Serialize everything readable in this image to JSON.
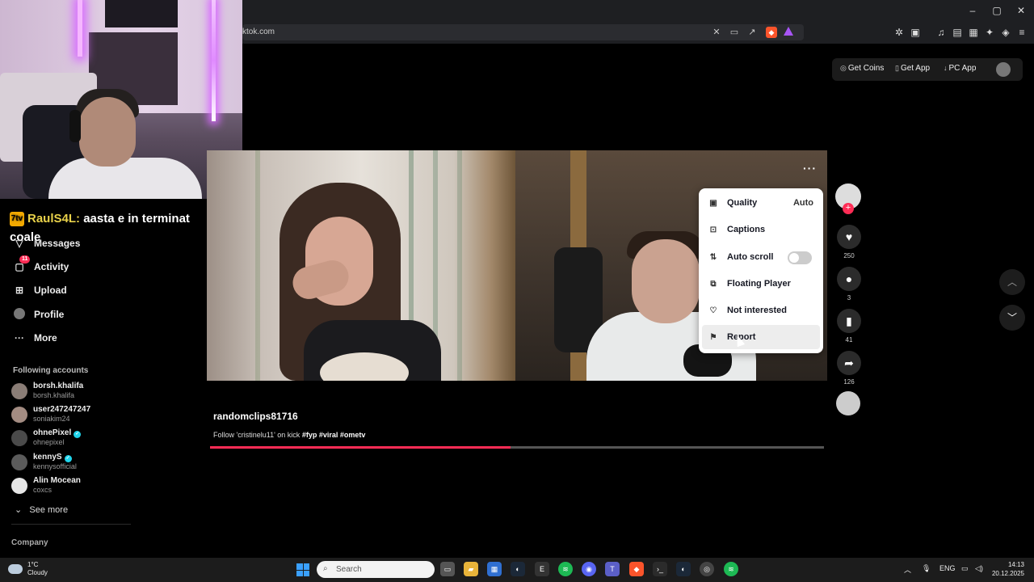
{
  "browser": {
    "url": "ktok.com",
    "window_controls": [
      "–",
      "▢",
      "✕"
    ]
  },
  "stream_chat": {
    "badge": "7tv",
    "username": "RaulS4L:",
    "message": "aasta e in terminat coale"
  },
  "sidebar": {
    "nav": [
      {
        "label": "Messages",
        "icon": "paper-plane-icon"
      },
      {
        "label": "Activity",
        "icon": "inbox-icon",
        "badge": "11"
      },
      {
        "label": "Upload",
        "icon": "plus-square-icon"
      },
      {
        "label": "Profile",
        "icon": "profile-icon"
      },
      {
        "label": "More",
        "icon": "more-icon"
      }
    ],
    "following_title": "Following accounts",
    "accounts": [
      {
        "name": "borsh.khalifa",
        "handle": "borsh.khalifa",
        "verified": false
      },
      {
        "name": "user247247247",
        "handle": "soniakim24",
        "verified": false
      },
      {
        "name": "ohnePixel",
        "handle": "ohnepixel",
        "verified": true
      },
      {
        "name": "kennyS",
        "handle": "kennysofficial",
        "verified": true
      },
      {
        "name": "Alin Mocean",
        "handle": "coxcs",
        "verified": false
      }
    ],
    "see_more": "See more",
    "company": "Company"
  },
  "topbar": {
    "get_coins": "Get Coins",
    "get_app": "Get App",
    "pc_app": "PC App"
  },
  "menu": {
    "items": [
      {
        "label": "Quality",
        "value": "Auto",
        "icon": "quality-icon"
      },
      {
        "label": "Captions",
        "icon": "captions-icon"
      },
      {
        "label": "Auto scroll",
        "icon": "auto-scroll-icon",
        "toggle": false
      },
      {
        "label": "Floating Player",
        "icon": "floating-player-icon"
      },
      {
        "label": "Not interested",
        "icon": "heart-broken-icon"
      },
      {
        "label": "Report",
        "icon": "flag-icon"
      }
    ]
  },
  "actions": {
    "likes": "250",
    "comments": "3",
    "saves": "41",
    "shares": "126"
  },
  "video": {
    "author": "randomclips81716",
    "description_prefix": "Follow 'cristinelu11' on kick",
    "hashtags": "#fyp #viral #ometv",
    "progress": 0.49
  },
  "taskbar": {
    "temperature": "1°C",
    "weather": "Cloudy",
    "search_placeholder": "Search",
    "language": "ENG",
    "time": "14:13",
    "date": "20.12.2025"
  },
  "colors": {
    "accent": "#fe2c55",
    "verified": "#20d5ec"
  }
}
